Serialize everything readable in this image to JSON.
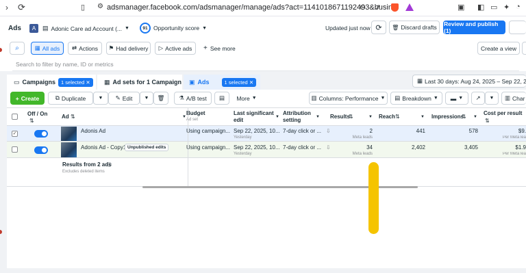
{
  "browser": {
    "url": "adsmanager.facebook.com/adsmanager/manage/ads?act=1141018671192493&busin..."
  },
  "header": {
    "title": "Ads",
    "account_badge": "A",
    "account_name": "Adonic Care ad Account (...",
    "opportunity_score_value": "91",
    "opportunity_score_label": "Opportunity score",
    "updated_text": "Updated just now",
    "discard_label": "Discard drafts",
    "review_label": "Review and publish (1)"
  },
  "filters": {
    "all_ads": "All ads",
    "actions": "Actions",
    "had_delivery": "Had delivery",
    "active_ads": "Active ads",
    "see_more": "See more",
    "create_view": "Create a view",
    "search_placeholder": "Search to filter by name, ID or metrics"
  },
  "tabs": {
    "campaigns": "Campaigns",
    "campaigns_selected": "1 selected",
    "adsets": "Ad sets for 1 Campaign",
    "ads": "Ads",
    "ads_selected": "1 selected",
    "date_range": "Last 30 days: Aug 24, 2025 – Sep 22, 2025"
  },
  "toolbar": {
    "create": "Create",
    "duplicate": "Duplicate",
    "edit": "Edit",
    "ab_test": "A/B test",
    "more": "More",
    "columns": "Columns: Performance",
    "breakdown": "Breakdown",
    "charts": "Char"
  },
  "columns": {
    "offon": "Off / On",
    "ad": "Ad",
    "budget": "Budget",
    "budget_sub": "Ad set",
    "last_edit": "Last significant edit",
    "attribution": "Attribution setting",
    "results": "Results",
    "reach": "Reach",
    "impressions": "Impressions",
    "cost": "Cost per result"
  },
  "rows": [
    {
      "name": "Adonis Ad",
      "badge": "",
      "budget": "Using campaign...",
      "edit": "Sep 22, 2025, 10...",
      "edit_sub": "Yesterday",
      "attribution": "7-day click or ...",
      "results": "2",
      "results_sub": "Meta leads",
      "reach": "441",
      "impressions": "578",
      "cost": "$9.",
      "cost_sub": "Per Meta lea"
    },
    {
      "name": "Adonis Ad - Copy1",
      "badge": "Unpublished edits",
      "budget": "Using campaign...",
      "edit": "Sep 22, 2025, 10...",
      "edit_sub": "Yesterday",
      "attribution": "7-day click or ...",
      "results": "34",
      "results_sub": "Meta leads",
      "reach": "2,402",
      "impressions": "3,405",
      "cost": "$1.9",
      "cost_sub": "Per Meta lea"
    }
  ],
  "summary": {
    "title": "Results from 2 ads",
    "sub": "Excludes deleted items"
  },
  "colors": {
    "accent": "#1877f2",
    "highlight": "#f5c400",
    "toggle": "#1877f2"
  }
}
